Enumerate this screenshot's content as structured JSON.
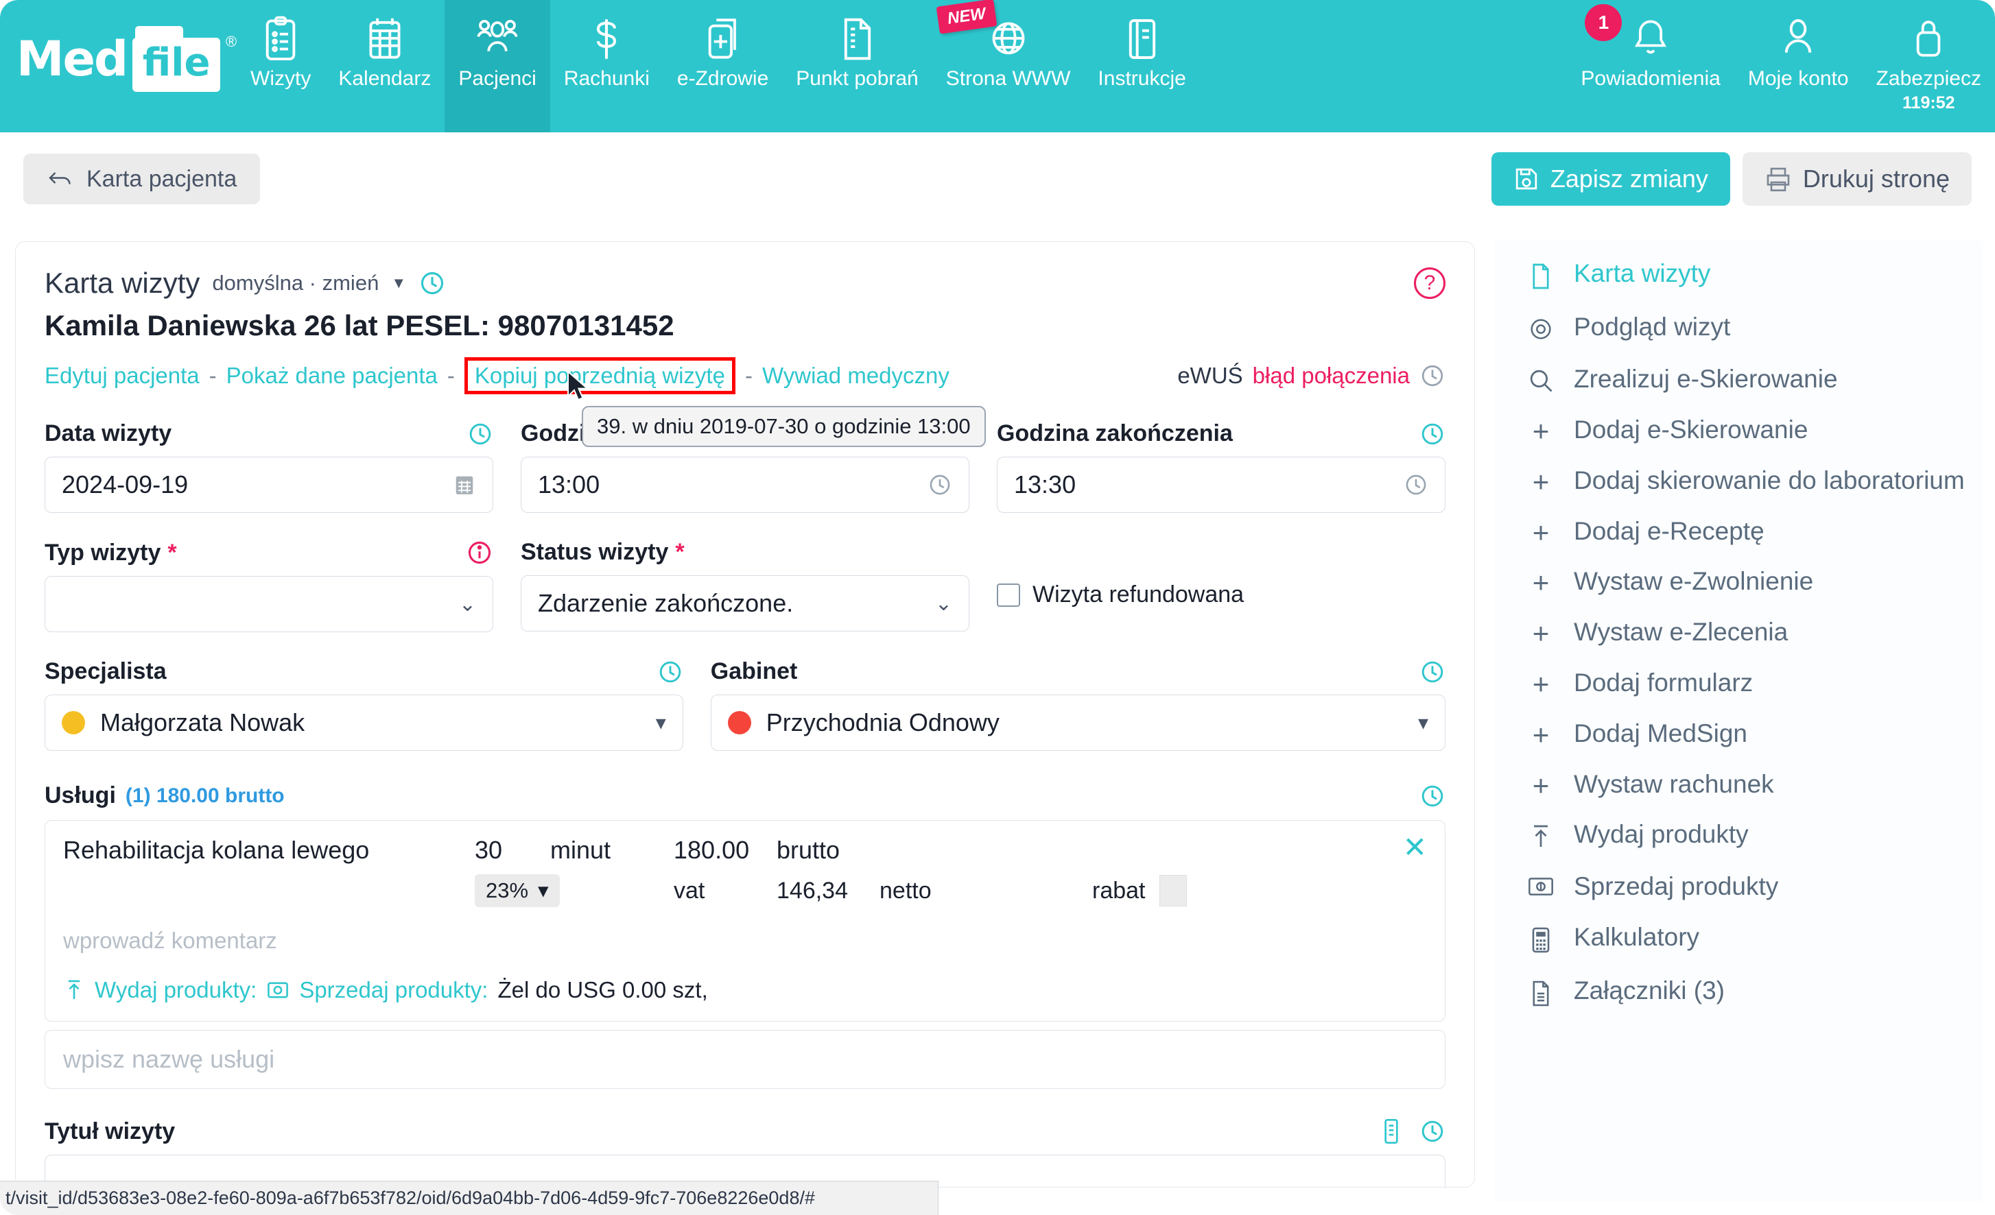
{
  "brand": {
    "med": "Med",
    "file": "file",
    "reg": "®"
  },
  "topnav": {
    "left_items": [
      {
        "label": "Wizyty",
        "icon": "clipboard-icon",
        "active": false
      },
      {
        "label": "Kalendarz",
        "icon": "calendar-icon",
        "active": false
      },
      {
        "label": "Pacjenci",
        "icon": "users-icon",
        "active": true
      },
      {
        "label": "Rachunki",
        "icon": "dollar-icon",
        "active": false
      },
      {
        "label": "e-Zdrowie",
        "icon": "medical-file-icon",
        "active": false
      },
      {
        "label": "Punkt pobrań",
        "icon": "document-icon",
        "active": false
      },
      {
        "label": "Strona WWW",
        "icon": "globe-icon",
        "active": false,
        "badge": "NEW"
      },
      {
        "label": "Instrukcje",
        "icon": "book-icon",
        "active": false
      }
    ],
    "right_items": [
      {
        "label": "Powiadomienia",
        "icon": "bell-icon",
        "badge_count": "1"
      },
      {
        "label": "Moje konto",
        "icon": "user-icon"
      },
      {
        "label": "Zabezpiecz",
        "icon": "lock-icon",
        "sub": "119:52"
      }
    ]
  },
  "subbar": {
    "back_label": "Karta pacjenta",
    "save_label": "Zapisz zmiany",
    "print_label": "Drukuj stronę"
  },
  "card": {
    "title": "Karta wizyty",
    "subtitle": "domyślna · zmień",
    "patient": "Kamila Daniewska 26 lat PESEL: 98070131452",
    "links": {
      "edit_patient": "Edytuj pacjenta",
      "show_patient_data": "Pokaż dane pacjenta",
      "copy_previous_visit": "Kopiuj poprzednią wizytę",
      "medical_interview": "Wywiad medyczny",
      "separator": "-"
    },
    "ewus": {
      "label": "eWUŚ",
      "status": "błąd połączenia"
    },
    "tooltip": "39. w dniu 2019-07-30 o godzinie 13:00",
    "fields": {
      "date_label": "Data wizyty",
      "date_value": "2024-09-19",
      "start_label": "Godzina rozpoczęcia",
      "start_value": "13:00",
      "end_label": "Godzina zakończenia",
      "end_value": "13:30",
      "type_label": "Typ wizyty",
      "type_value": "",
      "status_label": "Status wizyty",
      "status_value": "Zdarzenie zakończone.",
      "refund_label": "Wizyta refundowana",
      "specialist_label": "Specjalista",
      "specialist_value": "Małgorzata Nowak",
      "specialist_color": "#f5bf24",
      "office_label": "Gabinet",
      "office_value": "Przychodnia Odnowy",
      "office_color": "#f5453a",
      "required_mark": "*"
    },
    "services": {
      "heading": "Usługi",
      "meta": "(1) 180.00 brutto",
      "rows": [
        {
          "name": "Rehabilitacja kolana lewego",
          "qty": "30",
          "unit": "minut",
          "gross": "180.00",
          "gross_label": "brutto",
          "vat": "23%",
          "vat_label": "vat",
          "net": "146,34",
          "net_label": "netto",
          "discount_label": "rabat",
          "comment_placeholder": "wprowadź komentarz",
          "issue_products_label": "Wydaj produkty:",
          "sell_products_label": "Sprzedaj produkty:",
          "products_value": "Żel do USG 0.00 szt,",
          "close_label": "✕"
        }
      ],
      "add_placeholder": "wpisz nazwę usługi"
    },
    "visit_title_label": "Tytuł wizyty"
  },
  "rightbar": {
    "items": [
      {
        "label": "Karta wizyty",
        "icon": "file-icon",
        "active": true
      },
      {
        "label": "Podgląd wizyt",
        "icon": "eye-icon",
        "active": false
      },
      {
        "label": "Zrealizuj e-Skierowanie",
        "icon": "search-icon",
        "active": false
      },
      {
        "label": "Dodaj e-Skierowanie",
        "icon": "plus-icon",
        "active": false
      },
      {
        "label": "Dodaj skierowanie do laboratorium",
        "icon": "plus-icon",
        "active": false
      },
      {
        "label": "Dodaj e-Receptę",
        "icon": "plus-icon",
        "active": false
      },
      {
        "label": "Wystaw e-Zwolnienie",
        "icon": "plus-icon",
        "active": false
      },
      {
        "label": "Wystaw e-Zlecenia",
        "icon": "plus-icon",
        "active": false
      },
      {
        "label": "Dodaj formularz",
        "icon": "plus-icon",
        "active": false
      },
      {
        "label": "Dodaj MedSign",
        "icon": "plus-icon",
        "active": false
      },
      {
        "label": "Wystaw rachunek",
        "icon": "plus-icon",
        "active": false
      },
      {
        "label": "Wydaj produkty",
        "icon": "upload-icon",
        "active": false
      },
      {
        "label": "Sprzedaj produkty",
        "icon": "money-icon",
        "active": false
      },
      {
        "label": "Kalkulatory",
        "icon": "calculator-icon",
        "active": false
      },
      {
        "label": "Załączniki (3)",
        "icon": "attachment-icon",
        "active": false
      }
    ]
  },
  "statusbar": {
    "url": "t/visit_id/d53683e3-08e2-fe60-809a-a6f7b653f782/oid/6d9a04bb-7d06-4d59-9fc7-706e8226e0d8/#"
  },
  "colors": {
    "brand_teal": "#2ec6cd",
    "accent_pink": "#ec1e60",
    "link_blue": "#2f9ae0",
    "highlight_red": "#ff0000"
  }
}
